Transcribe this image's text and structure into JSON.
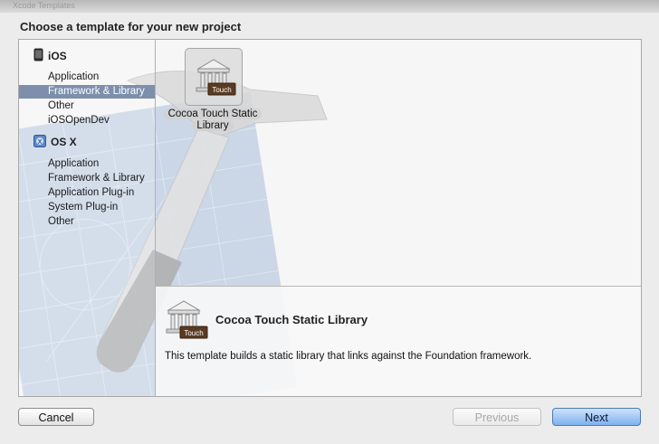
{
  "window": {
    "title_strip": "Xcode Templates"
  },
  "dialog_title": "Choose a template for your new project",
  "sidebar": {
    "groups": [
      {
        "label": "iOS",
        "icon": "iphone-icon",
        "items": [
          "Application",
          "Framework & Library",
          "Other",
          "iOSOpenDev"
        ]
      },
      {
        "label": "OS X",
        "icon": "osx-icon",
        "items": [
          "Application",
          "Framework & Library",
          "Application Plug-in",
          "System Plug-in",
          "Other"
        ]
      }
    ],
    "selected": {
      "group": "iOS",
      "item": "Framework & Library"
    }
  },
  "templates": [
    {
      "name_line1": "Cocoa Touch Static",
      "name_line2": "Library",
      "badge": "Touch",
      "icon": "library-building-icon"
    }
  ],
  "description": {
    "title": "Cocoa Touch Static Library",
    "text": "This template builds a static library that links against the Foundation framework.",
    "badge": "Touch"
  },
  "buttons": {
    "cancel": "Cancel",
    "previous": "Previous",
    "next": "Next"
  },
  "colors": {
    "selection": "#7d8fac",
    "default_button": "#7eb1ef",
    "blueprint": "#9fb6d6"
  }
}
